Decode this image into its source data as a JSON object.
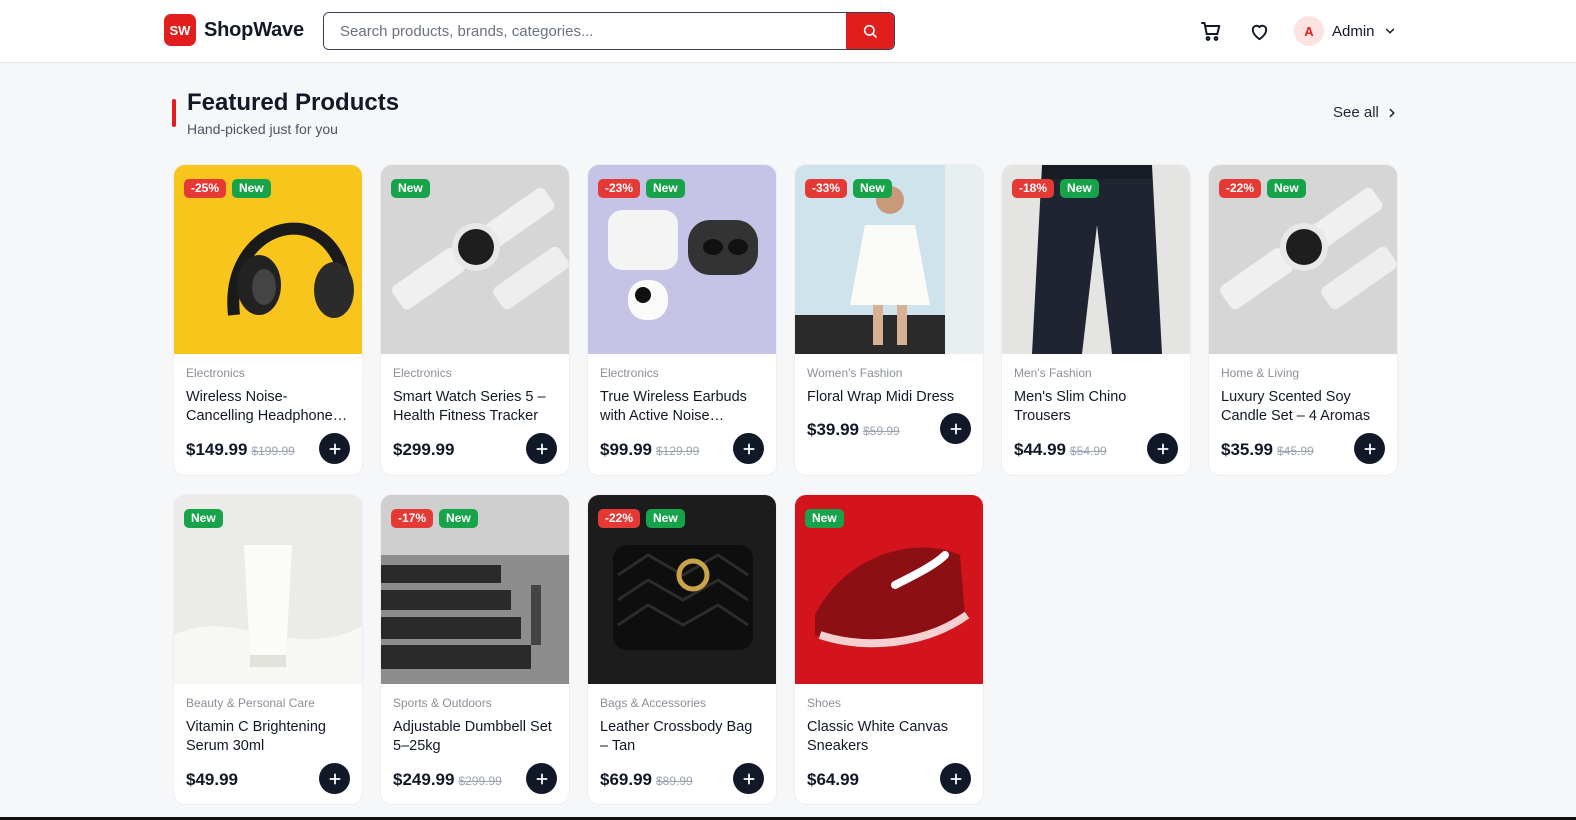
{
  "app": {
    "brand_mark": "SW",
    "brand_name": "ShopWave"
  },
  "header": {
    "search_placeholder": "Search products, brands, categories...",
    "user_initial": "A",
    "user_name": "Admin"
  },
  "section": {
    "title": "Featured Products",
    "subtitle": "Hand-picked just for you",
    "see_all": "See all"
  },
  "colors": {
    "brand": "#e11d1d",
    "discount": "#e53935",
    "new": "#16a34a",
    "dark": "#111827"
  },
  "products": [
    {
      "discount": "-25%",
      "new": "New",
      "category": "Electronics",
      "name": "Wireless Noise-Cancelling Headphone…",
      "price": "$149.99",
      "old_price": "$199.99",
      "image": "headphones"
    },
    {
      "discount": "",
      "new": "New",
      "category": "Electronics",
      "name": "Smart Watch Series 5 – Health Fitness Tracker",
      "price": "$299.99",
      "old_price": "",
      "image": "smartwatch"
    },
    {
      "discount": "-23%",
      "new": "New",
      "category": "Electronics",
      "name": "True Wireless Earbuds with Active Noise…",
      "price": "$99.99",
      "old_price": "$129.99",
      "image": "earbuds"
    },
    {
      "discount": "-33%",
      "new": "New",
      "category": "Women's Fashion",
      "name": "Floral Wrap Midi Dress",
      "price": "$39.99",
      "old_price": "$59.99",
      "image": "dress"
    },
    {
      "discount": "-18%",
      "new": "New",
      "category": "Men's Fashion",
      "name": "Men's Slim Chino Trousers",
      "price": "$44.99",
      "old_price": "$54.99",
      "image": "trousers"
    },
    {
      "discount": "-22%",
      "new": "New",
      "category": "Home & Living",
      "name": "Luxury Scented Soy Candle Set – 4 Aromas",
      "price": "$35.99",
      "old_price": "$45.99",
      "image": "smartwatch"
    },
    {
      "discount": "",
      "new": "New",
      "category": "Beauty & Personal Care",
      "name": "Vitamin C Brightening Serum 30ml",
      "price": "$49.99",
      "old_price": "",
      "image": "serum"
    },
    {
      "discount": "-17%",
      "new": "New",
      "category": "Sports & Outdoors",
      "name": "Adjustable Dumbbell Set 5–25kg",
      "price": "$249.99",
      "old_price": "$299.99",
      "image": "dumbbells"
    },
    {
      "discount": "-22%",
      "new": "New",
      "category": "Bags & Accessories",
      "name": "Leather Crossbody Bag – Tan",
      "price": "$69.99",
      "old_price": "$89.99",
      "image": "bag"
    },
    {
      "discount": "",
      "new": "New",
      "category": "Shoes",
      "name": "Classic White Canvas Sneakers",
      "price": "$64.99",
      "old_price": "",
      "image": "sneaker"
    }
  ]
}
